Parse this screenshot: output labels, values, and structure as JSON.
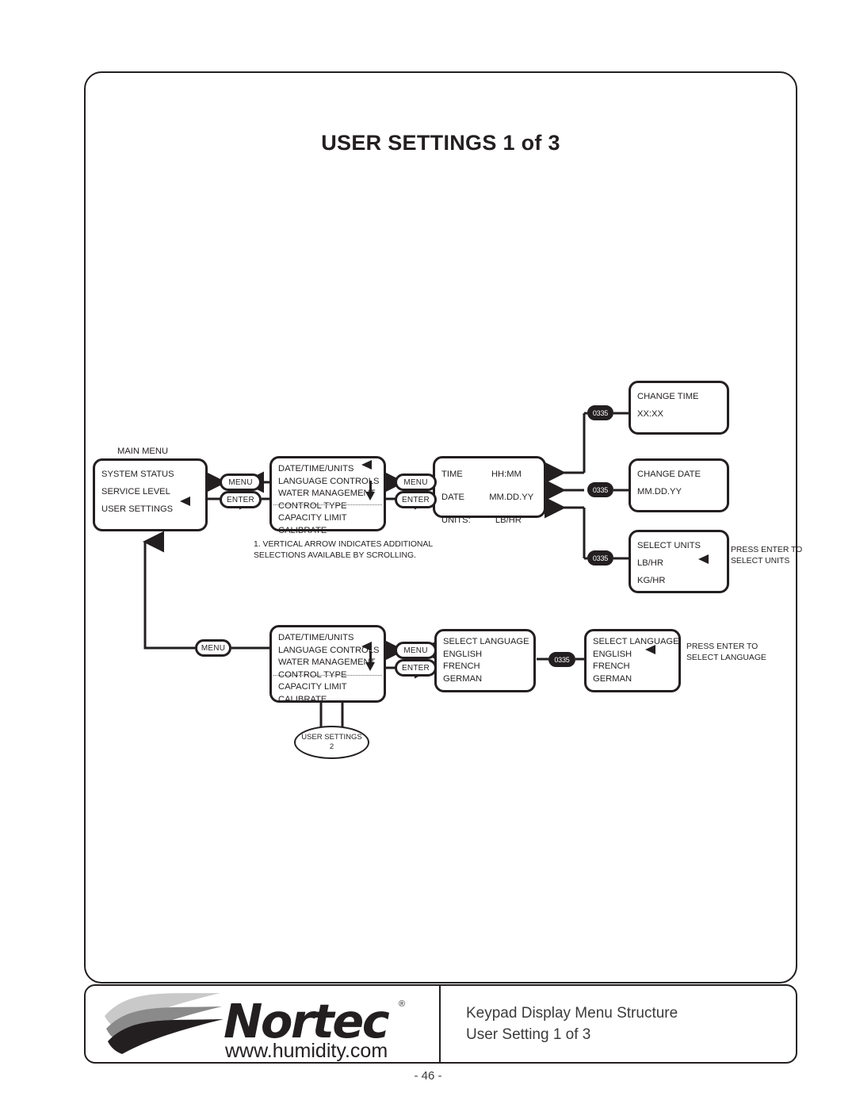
{
  "page": {
    "title": "USER SETTINGS 1 of 3",
    "number": "- 46 -"
  },
  "footer": {
    "logo_name": "Nortec",
    "logo_registered": "®",
    "logo_url": "www.humidity.com",
    "caption_line1": "Keypad Display Menu Structure",
    "caption_line2": "User Setting 1 of 3"
  },
  "keys": {
    "menu": "MENU",
    "enter": "ENTER",
    "arrows": "0335"
  },
  "notes": {
    "footnote": "1. VERTICAL ARROW INDICATES ADDITIONAL\n     SELECTIONS AVAILABLE BY SCROLLING.",
    "press_enter_units": "PRESS ENTER TO\nSELECT UNITS",
    "press_enter_language": "PRESS ENTER TO\nSELECT LANGUAGE"
  },
  "connector": {
    "label": "USER SETTINGS",
    "number": "2"
  },
  "screens": {
    "main_menu": {
      "caption": "MAIN MENU",
      "items": [
        "SYSTEM STATUS",
        "SERVICE LEVEL",
        "USER SETTINGS"
      ],
      "selected": "USER SETTINGS"
    },
    "settings_top": {
      "items": [
        "DATE/TIME/UNITS",
        "LANGUAGE CONTROLS",
        "WATER MANAGEMENT",
        "CONTROL TYPE",
        "CAPACITY LIMIT",
        "CALIBRATE"
      ],
      "selected": "DATE/TIME/UNITS"
    },
    "settings_bottom": {
      "items": [
        "DATE/TIME/UNITS",
        "LANGUAGE CONTROLS",
        "WATER MANAGEMENT",
        "CONTROL TYPE",
        "CAPACITY LIMIT",
        "CALIBRATE"
      ],
      "selected": "LANGUAGE CONTROLS"
    },
    "date_time_units": {
      "rows": [
        {
          "label": "TIME",
          "value": "HH:MM"
        },
        {
          "label": "DATE",
          "value": "MM.DD.YY"
        },
        {
          "label": "UNITS:",
          "value": "LB/HR"
        }
      ]
    },
    "change_time": {
      "title": "CHANGE TIME",
      "value": "XX:XX"
    },
    "change_date": {
      "title": "CHANGE DATE",
      "value": "MM.DD.YY"
    },
    "select_units": {
      "title": "SELECT UNITS",
      "options": [
        "LB/HR",
        "KG/HR"
      ],
      "selected": "LB/HR"
    },
    "select_language_left": {
      "title": "SELECT LANGUAGE",
      "options": [
        "ENGLISH",
        "FRENCH",
        "GERMAN"
      ]
    },
    "select_language_right": {
      "title": "SELECT LANGUAGE",
      "options": [
        "ENGLISH",
        "FRENCH",
        "GERMAN"
      ],
      "selected": "ENGLISH"
    }
  }
}
